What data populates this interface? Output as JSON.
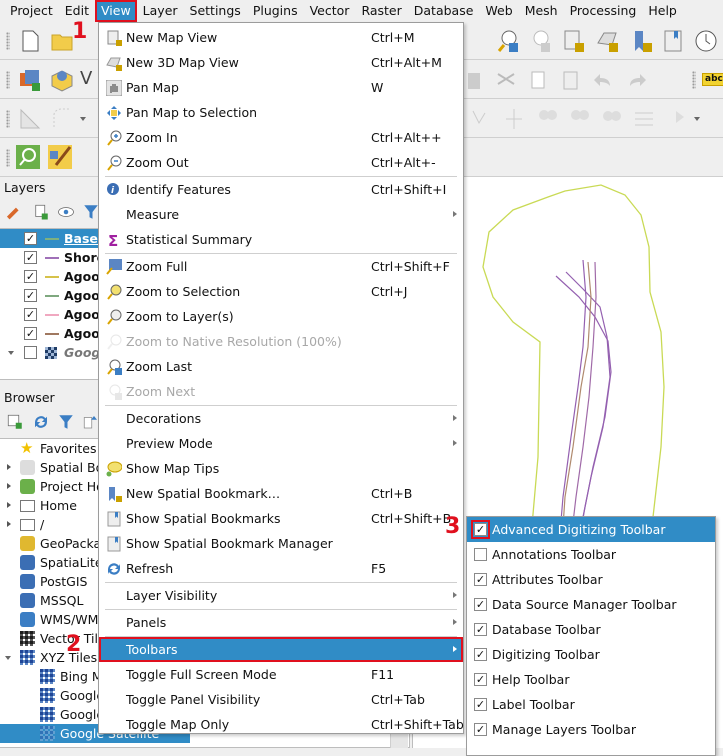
{
  "menubar": {
    "items": [
      "Project",
      "Edit",
      "View",
      "Layer",
      "Settings",
      "Plugins",
      "Vector",
      "Raster",
      "Database",
      "Web",
      "Mesh",
      "Processing",
      "Help"
    ],
    "active": "View"
  },
  "annotations": {
    "step1": "1",
    "step2": "2",
    "step3": "3"
  },
  "layers_panel": {
    "title": "Layers",
    "items": [
      {
        "label": "Baseli",
        "checked": true,
        "color": "#7fb07f",
        "selected": true
      },
      {
        "label": "Shore",
        "checked": true,
        "color": "#a070b8"
      },
      {
        "label": "Agoo",
        "checked": true,
        "color": "#d6c24a"
      },
      {
        "label": "Agoo",
        "checked": true,
        "color": "#7fa87f"
      },
      {
        "label": "Agoo",
        "checked": true,
        "color": "#f0a8c0"
      },
      {
        "label": "Agoo",
        "checked": true,
        "color": "#a07860"
      },
      {
        "label": "Googl",
        "checked": false,
        "group": true
      }
    ]
  },
  "browser_panel": {
    "title": "Browser",
    "items": [
      {
        "label": "Favorites",
        "icon": "star-icon",
        "expandable": false
      },
      {
        "label": "Spatial Bo",
        "icon": "bookmark-icon",
        "expandable": true
      },
      {
        "label": "Project Ho",
        "icon": "project-home-icon",
        "expandable": true
      },
      {
        "label": "Home",
        "icon": "home-folder-icon",
        "expandable": true
      },
      {
        "label": "/",
        "icon": "folder-icon",
        "expandable": true
      },
      {
        "label": "GeoPacka",
        "icon": "geopackage-icon",
        "expandable": false
      },
      {
        "label": "SpatiaLite",
        "icon": "spatialite-icon",
        "expandable": false
      },
      {
        "label": "PostGIS",
        "icon": "postgis-icon",
        "expandable": false
      },
      {
        "label": "MSSQL",
        "icon": "mssql-icon",
        "expandable": false
      },
      {
        "label": "WMS/WMT",
        "icon": "wms-icon",
        "expandable": false
      },
      {
        "label": "Vector Tile",
        "icon": "vector-tile-icon",
        "expandable": false
      },
      {
        "label": "XYZ Tiles",
        "icon": "xyz-tiles-icon",
        "expanded": true
      },
      {
        "label": "Bing M",
        "icon": "tile-icon",
        "child": true
      },
      {
        "label": "Google",
        "icon": "tile-icon",
        "child": true
      },
      {
        "label": "Google",
        "icon": "tile-icon",
        "child": true
      },
      {
        "label": "Google Satellite",
        "icon": "tile-icon",
        "child": true,
        "selected": true
      }
    ]
  },
  "view_menu": {
    "items": [
      {
        "label": "New Map View",
        "shortcut": "Ctrl+M",
        "icon": "new-map-view-icon"
      },
      {
        "label": "New 3D Map View",
        "shortcut": "Ctrl+Alt+M",
        "icon": "new-3d-map-view-icon"
      },
      {
        "label": "Pan Map",
        "shortcut": "W",
        "icon": "pan-hand-icon"
      },
      {
        "label": "Pan Map to Selection",
        "shortcut": "",
        "icon": "pan-to-selection-icon"
      },
      {
        "label": "Zoom In",
        "shortcut": "Ctrl+Alt++",
        "icon": "zoom-in-icon"
      },
      {
        "label": "Zoom Out",
        "shortcut": "Ctrl+Alt+-",
        "icon": "zoom-out-icon"
      },
      {
        "label": "Identify Features",
        "shortcut": "Ctrl+Shift+I",
        "icon": "identify-icon"
      },
      {
        "label": "Measure",
        "shortcut": "",
        "submenu": true
      },
      {
        "label": "Statistical Summary",
        "shortcut": "",
        "icon": "sigma-icon"
      },
      {
        "label": "Zoom Full",
        "shortcut": "Ctrl+Shift+F",
        "icon": "zoom-full-icon"
      },
      {
        "label": "Zoom to Selection",
        "shortcut": "Ctrl+J",
        "icon": "zoom-to-selection-icon"
      },
      {
        "label": "Zoom to Layer(s)",
        "shortcut": "",
        "icon": "zoom-to-layer-icon"
      },
      {
        "label": "Zoom to Native Resolution (100%)",
        "shortcut": "",
        "icon": "zoom-native-icon",
        "disabled": true
      },
      {
        "label": "Zoom Last",
        "shortcut": "",
        "icon": "zoom-last-icon"
      },
      {
        "label": "Zoom Next",
        "shortcut": "",
        "icon": "zoom-next-icon",
        "disabled": true
      },
      {
        "label": "Decorations",
        "shortcut": "",
        "submenu": true
      },
      {
        "label": "Preview Mode",
        "shortcut": "",
        "submenu": true
      },
      {
        "label": "Show Map Tips",
        "shortcut": "",
        "icon": "map-tips-icon"
      },
      {
        "label": "New Spatial Bookmark…",
        "shortcut": "Ctrl+B",
        "icon": "new-bookmark-icon"
      },
      {
        "label": "Show Spatial Bookmarks",
        "shortcut": "Ctrl+Shift+B",
        "icon": "bookmarks-icon"
      },
      {
        "label": "Show Spatial Bookmark Manager",
        "shortcut": "",
        "icon": "bookmark-manager-icon"
      },
      {
        "label": "Refresh",
        "shortcut": "F5",
        "icon": "refresh-icon"
      },
      {
        "label": "Layer Visibility",
        "shortcut": "",
        "submenu": true
      },
      {
        "label": "Panels",
        "shortcut": "",
        "submenu": true
      },
      {
        "label": "Toolbars",
        "shortcut": "",
        "submenu": true,
        "highlighted": true
      },
      {
        "label": "Toggle Full Screen Mode",
        "shortcut": "F11"
      },
      {
        "label": "Toggle Panel Visibility",
        "shortcut": "Ctrl+Tab"
      },
      {
        "label": "Toggle Map Only",
        "shortcut": "Ctrl+Shift+Tab"
      }
    ]
  },
  "toolbars_submenu": {
    "items": [
      {
        "label": "Advanced Digitizing Toolbar",
        "checked": true,
        "highlighted": true
      },
      {
        "label": "Annotations Toolbar",
        "checked": false
      },
      {
        "label": "Attributes Toolbar",
        "checked": true
      },
      {
        "label": "Data Source Manager Toolbar",
        "checked": true
      },
      {
        "label": "Database Toolbar",
        "checked": true
      },
      {
        "label": "Digitizing Toolbar",
        "checked": true
      },
      {
        "label": "Help Toolbar",
        "checked": true
      },
      {
        "label": "Label Toolbar",
        "checked": true
      },
      {
        "label": "Manage Layers Toolbar",
        "checked": true
      }
    ]
  },
  "glyphs": {
    "check": "✓",
    "sigma": "Σ",
    "star": "★",
    "hand": "✋",
    "refresh": "⟳",
    "abc": "abc"
  }
}
